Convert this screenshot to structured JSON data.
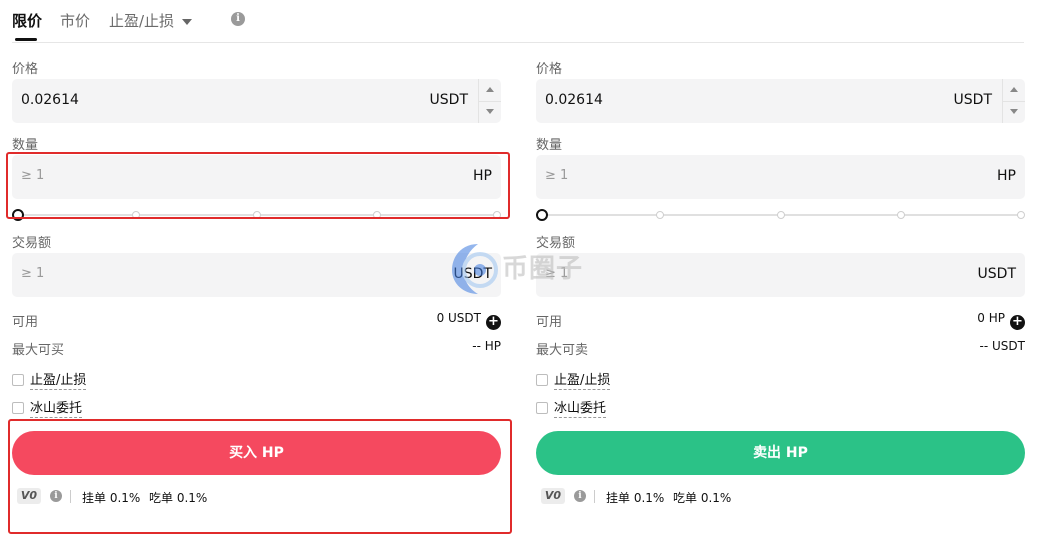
{
  "tabs": [
    {
      "label": "限价",
      "active": true
    },
    {
      "label": "市价",
      "active": false
    },
    {
      "label": "止盈/止损",
      "active": false,
      "has_dropdown": true
    }
  ],
  "buy": {
    "price_label": "价格",
    "price_value": "0.02614",
    "price_unit": "USDT",
    "qty_label": "数量",
    "qty_placeholder": "≥ 1",
    "qty_unit": "HP",
    "amount_label": "交易额",
    "amount_placeholder": "≥ 1",
    "amount_unit": "USDT",
    "available_label": "可用",
    "available_value": "0 USDT",
    "max_label": "最大可买",
    "max_value": "-- HP",
    "tpsl_label": "止盈/止损",
    "iceberg_label": "冰山委托",
    "button_label": "买入 HP",
    "vip_level": "V0",
    "maker_fee": "挂单 0.1%",
    "taker_fee": "吃单 0.1%"
  },
  "sell": {
    "price_label": "价格",
    "price_value": "0.02614",
    "price_unit": "USDT",
    "qty_label": "数量",
    "qty_placeholder": "≥ 1",
    "qty_unit": "HP",
    "amount_label": "交易额",
    "amount_placeholder": "≥ 1",
    "amount_unit": "USDT",
    "available_label": "可用",
    "available_value": "0 HP",
    "max_label": "最大可卖",
    "max_value": "-- USDT",
    "tpsl_label": "止盈/止损",
    "iceberg_label": "冰山委托",
    "button_label": "卖出 HP",
    "vip_level": "V0",
    "maker_fee": "挂单 0.1%",
    "taker_fee": "吃单 0.1%"
  },
  "watermark": {
    "text": "币圈子"
  },
  "colors": {
    "buy": "#f5495f",
    "sell": "#2bc287",
    "highlight": "#e02b2b",
    "field_bg": "#f4f4f5"
  }
}
